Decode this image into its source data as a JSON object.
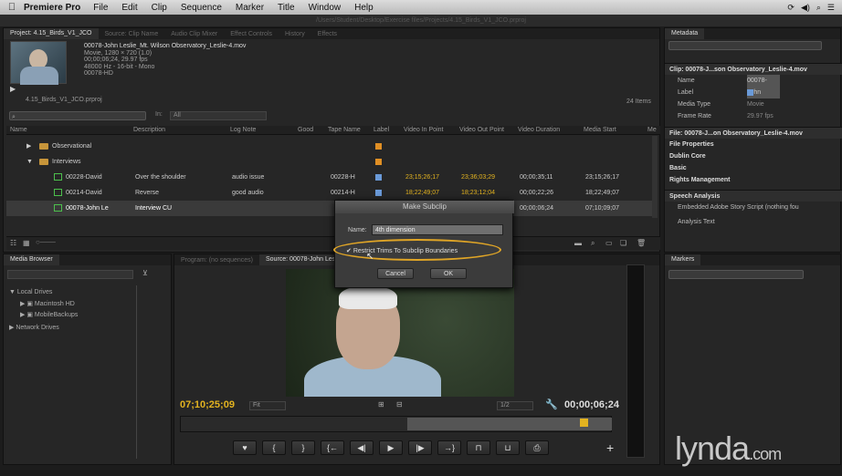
{
  "menubar": {
    "app": "Premiere Pro",
    "items": [
      "File",
      "Edit",
      "Clip",
      "Sequence",
      "Marker",
      "Title",
      "Window",
      "Help"
    ]
  },
  "window_title": "/Users/Student/Desktop/Exercise files/Projects/4.15_Birds_V1_JCO.prproj",
  "project": {
    "tabs": [
      "Project: 4.15_Birds_V1_JCO",
      "Source: Clip Name",
      "Audio Clip Mixer",
      "Effect Controls",
      "History",
      "Effects"
    ],
    "clip_info": [
      "00078-John Leslie_Mt. Wilson Observatory_Leslie-4.mov",
      "Movie, 1280 × 720 (1.0)",
      "00;00;06;24, 29.97 fps",
      "48000 Hz - 16-bit - Mono",
      "00078-HD"
    ],
    "project_file": "4.15_Birds_V1_JCO.prproj",
    "items_count": "24 Items",
    "in_label": "In:",
    "in_value": "All",
    "columns": [
      "Name",
      "Description",
      "Log Note",
      "Good",
      "Tape Name",
      "Label",
      "Video In Point",
      "Video Out Point",
      "Video Duration",
      "Media Start",
      "Me"
    ],
    "rows": [
      {
        "name": "Observational",
        "type": "folder",
        "indent": 0,
        "label": "#e08f24"
      },
      {
        "name": "Interviews",
        "type": "folder",
        "indent": 0,
        "label": "#e08f24"
      },
      {
        "name": "00228-David",
        "desc": "Over the shoulder",
        "log": "audio issue",
        "tape": "00228-H",
        "label": "#6a9ad8",
        "vin": "23;15;26;17",
        "vout": "23;36;03;29",
        "dur": "00;00;35;11",
        "mstart": "23;15;26;17",
        "type": "clip"
      },
      {
        "name": "00214-David",
        "desc": "Reverse",
        "log": "good audio",
        "tape": "00214-H",
        "label": "#6a9ad8",
        "vin": "18;22;49;07",
        "vout": "18;23;12;04",
        "dur": "00;00;22;26",
        "mstart": "18;22;49;07",
        "type": "clip"
      },
      {
        "name": "00078-John Le",
        "desc": "Interview CU",
        "log": "",
        "tape": "",
        "label": "#6a9ad8",
        "vin": "",
        "vout": "",
        "dur": "00;00;06;24",
        "mstart": "07;10;09;07",
        "type": "clip",
        "selected": true
      }
    ]
  },
  "metadata": {
    "tab": "Metadata",
    "clip_title": "Clip: 00078-J...son Observatory_Leslie-4.mov",
    "fields": [
      {
        "k": "Name",
        "v": "00078-John"
      },
      {
        "k": "Label",
        "v": ""
      },
      {
        "k": "Media Type",
        "v": "Movie"
      },
      {
        "k": "Frame Rate",
        "v": "29.97 fps"
      }
    ],
    "file_row": "File: 00078-J...on Observatory_Leslie-4.mov",
    "sections": [
      "File Properties",
      "Dublin Core",
      "Basic",
      "Rights Management"
    ],
    "speech_title": "Speech Analysis",
    "speech_script": "Embedded Adobe Story Script (nothing fou",
    "analysis_text": "Analysis Text"
  },
  "media_browser": {
    "tab": "Media Browser",
    "local": "Local Drives",
    "drives": [
      "Macintosh HD",
      "MobileBackups"
    ],
    "network": "Network Drives"
  },
  "program": {
    "tabs": [
      "Program: (no sequences)",
      "Source: 00078-John Leslie_Mt. Wilson Observatory_Leslie-4.mov"
    ],
    "tc_left": "07;10;25;09",
    "fit": "Fit",
    "quality": "1/2",
    "tc_right": "00;00;06;24",
    "controls": [
      "♥",
      "{",
      "}",
      "{←",
      "◀|",
      "▶",
      "|▶",
      "→}",
      "⊓",
      "⊔",
      "⎙"
    ],
    "plus": "+"
  },
  "markers": {
    "tab": "Markers"
  },
  "dialog": {
    "title": "Make Subclip",
    "name_label": "Name:",
    "name_value": "4th dimension",
    "checkbox": "Restrict Trims To Subclip Boundaries",
    "cancel": "Cancel",
    "ok": "OK"
  },
  "watermark": {
    "text": "lynda",
    "dot": ".com"
  }
}
